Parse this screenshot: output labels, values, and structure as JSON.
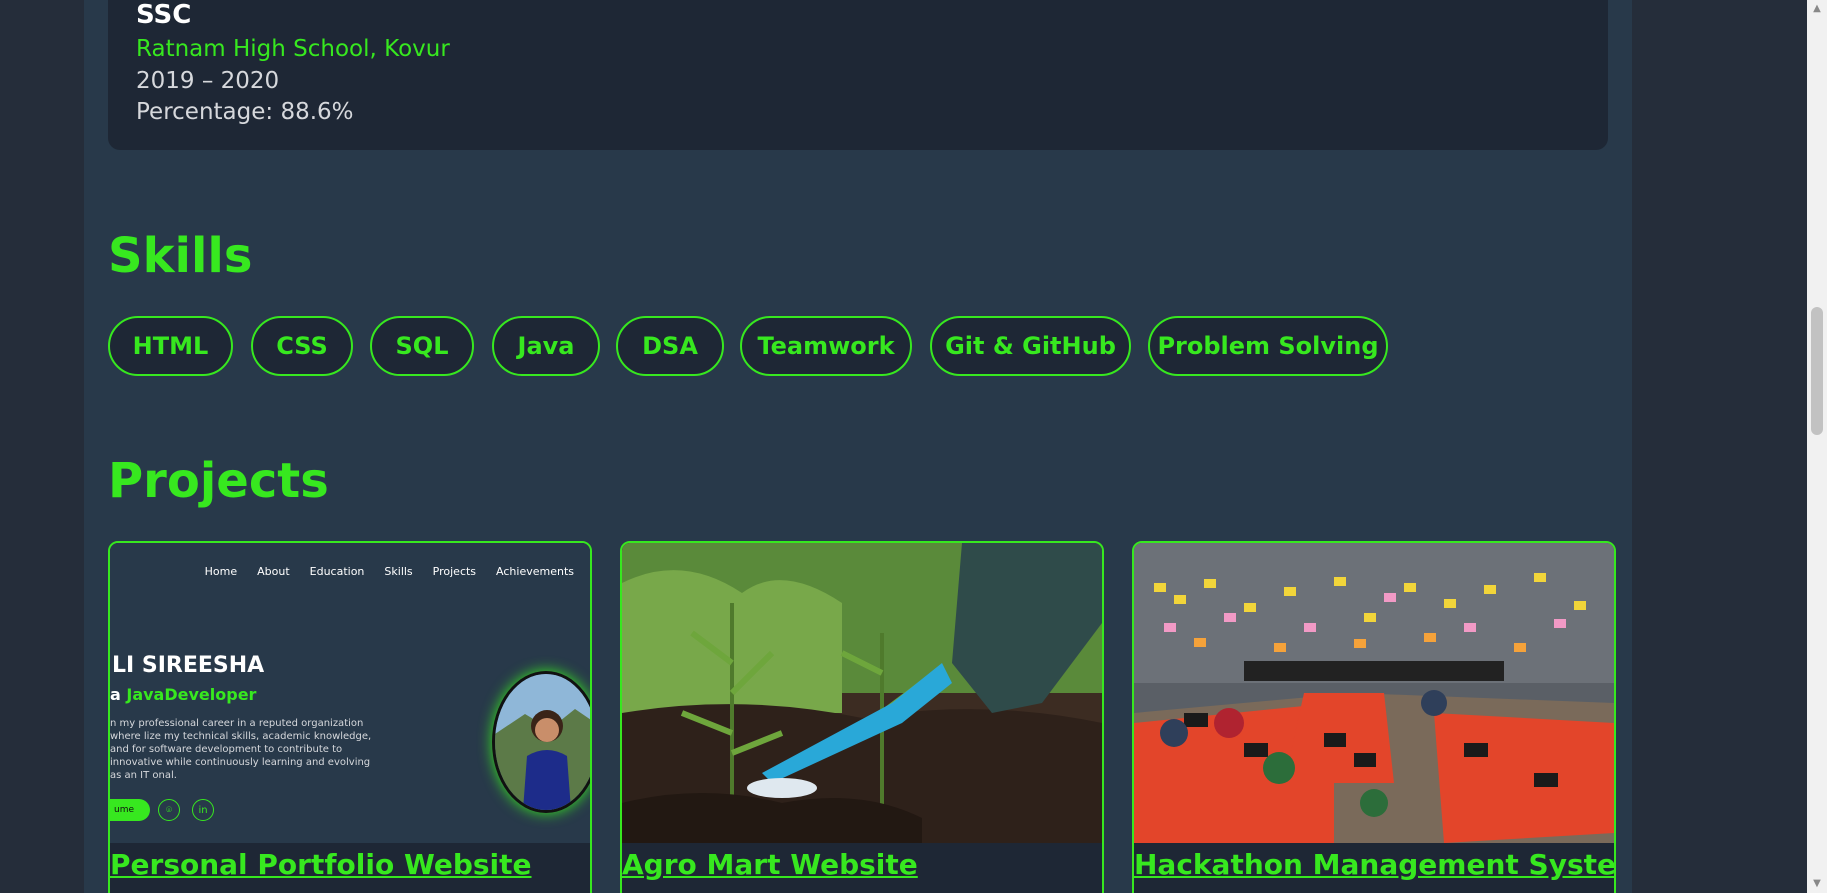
{
  "education": {
    "title": "SSC",
    "school": "Ratnam High School, Kovur",
    "years": "2019 – 2020",
    "percentage": "Percentage: 88.6%"
  },
  "skills": {
    "heading": "Skills",
    "items": [
      "HTML",
      "CSS",
      "SQL",
      "Java",
      "DSA",
      "Teamwork",
      "Git & GitHub",
      "Problem Solving"
    ]
  },
  "projects": {
    "heading": "Projects",
    "items": [
      {
        "title": "Personal Portfolio Website"
      },
      {
        "title": "Agro Mart Website"
      },
      {
        "title": "Hackathon Management System"
      }
    ]
  },
  "portfolio_preview": {
    "nav": [
      "Home",
      "About",
      "Education",
      "Skills",
      "Projects",
      "Achievements"
    ],
    "name": "LI SIREESHA",
    "role_prefix": "a ",
    "role_highlight": "JavaDeveloper",
    "description": "n my professional career in a reputed organization where lize my technical skills, academic knowledge, and for software development to contribute to innovative while continuously learning and evolving as an IT onal.",
    "button": "ume"
  },
  "colors": {
    "accent": "#37e81f",
    "background": "#252d3a",
    "panel": "#28394a",
    "card": "#1e2735"
  }
}
